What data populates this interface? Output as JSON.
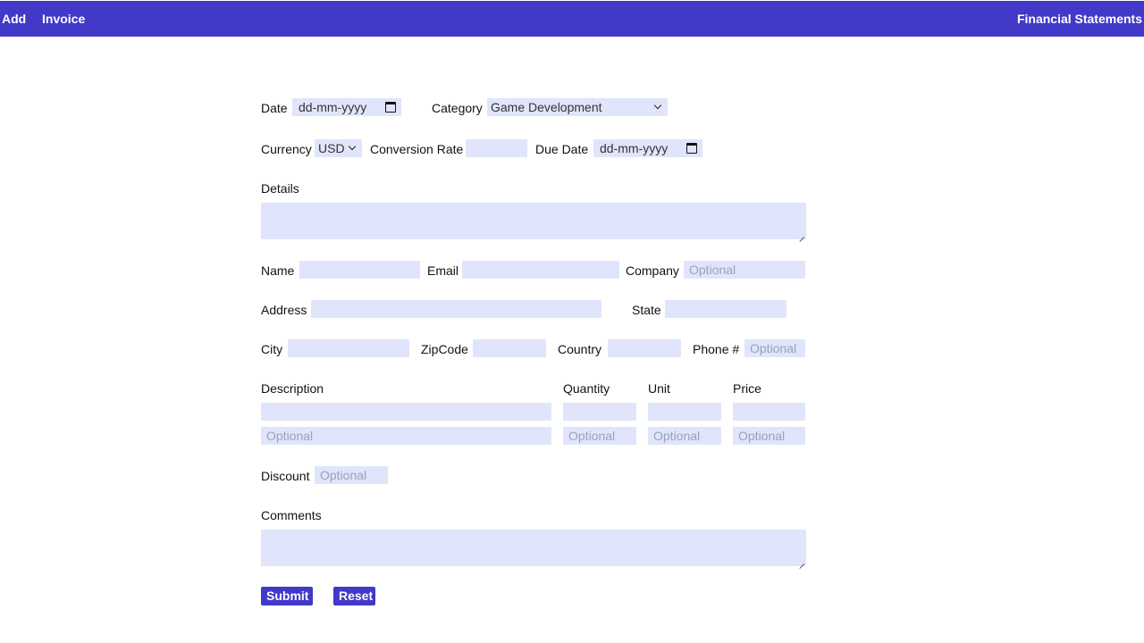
{
  "nav": {
    "add": "Add",
    "invoice": "Invoice",
    "financial_statements": "Financial Statements"
  },
  "form": {
    "date_label": "Date",
    "date_value": "dd-mm-yyyy",
    "category_label": "Category",
    "category_value": "Game Development",
    "currency_label": "Currency",
    "currency_value": "USD",
    "conversion_rate_label": "Conversion Rate",
    "due_date_label": "Due Date",
    "due_date_value": "dd-mm-yyyy",
    "details_label": "Details",
    "name_label": "Name",
    "email_label": "Email",
    "company_label": "Company",
    "company_placeholder": "Optional",
    "address_label": "Address",
    "state_label": "State",
    "city_label": "City",
    "zipcode_label": "ZipCode",
    "country_label": "Country",
    "phone_label": "Phone #",
    "phone_placeholder": "Optional",
    "items": {
      "description_label": "Description",
      "quantity_label": "Quantity",
      "unit_label": "Unit",
      "price_label": "Price",
      "optional_placeholder": "Optional"
    },
    "discount_label": "Discount",
    "discount_placeholder": "Optional",
    "comments_label": "Comments",
    "submit_label": "Submit",
    "reset_label": "Reset"
  }
}
